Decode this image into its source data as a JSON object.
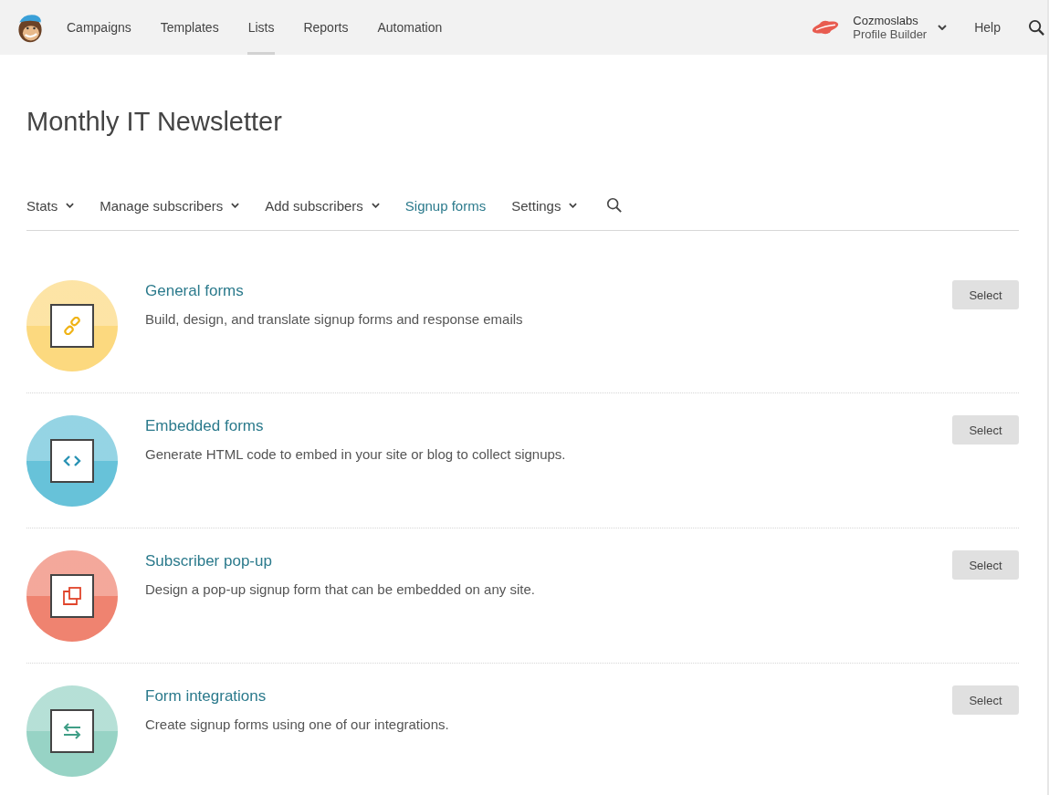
{
  "top_nav": {
    "items": [
      {
        "label": "Campaigns",
        "selected": false
      },
      {
        "label": "Templates",
        "selected": false
      },
      {
        "label": "Lists",
        "selected": true
      },
      {
        "label": "Reports",
        "selected": false
      },
      {
        "label": "Automation",
        "selected": false
      }
    ],
    "account": {
      "name": "Cozmoslabs",
      "subtitle": "Profile Builder"
    },
    "help": "Help"
  },
  "page_title": "Monthly IT Newsletter",
  "sub_nav": [
    {
      "label": "Stats",
      "dropdown": true,
      "selected": false
    },
    {
      "label": "Manage subscribers",
      "dropdown": true,
      "selected": false
    },
    {
      "label": "Add subscribers",
      "dropdown": true,
      "selected": false
    },
    {
      "label": "Signup forms",
      "dropdown": false,
      "selected": true
    },
    {
      "label": "Settings",
      "dropdown": true,
      "selected": false
    }
  ],
  "forms": [
    {
      "kind": "link",
      "color": "#fcd97f",
      "title": "General forms",
      "description": "Build, design, and translate signup forms and response emails",
      "button": "Select"
    },
    {
      "kind": "code",
      "color": "#67c2d9",
      "title": "Embedded forms",
      "description": "Generate HTML code to embed in your site or blog to collect signups.",
      "button": "Select"
    },
    {
      "kind": "popup",
      "color": "#ef8370",
      "title": "Subscriber pop-up",
      "description": "Design a pop-up signup form that can be embedded on any site.",
      "button": "Select"
    },
    {
      "kind": "integrations",
      "color": "#97d3c5",
      "title": "Form integrations",
      "description": "Create signup forms using one of our integrations.",
      "button": "Select"
    }
  ]
}
